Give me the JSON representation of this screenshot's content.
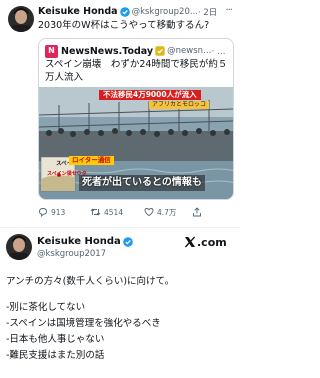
{
  "tweet": {
    "author_name": "Keisuke Honda",
    "handle": "@kskgroup20...",
    "time": "· 2日",
    "more_label": "···",
    "text": "2030年のW杯はこうやって移動するん?",
    "quote": {
      "source_name": "NewsNews.Today",
      "source_handle": "@newsne...",
      "source_time": "· 2日",
      "source_logo_letter": "N",
      "text": "スペイン崩壊　わずか24時間で移民が約５万人流入",
      "image": {
        "banner": "不法移民4万9000人が流入",
        "sub_banner": "アフリカとモロッコ",
        "reuters": "ロイター通信",
        "map_label": "スペイン",
        "map_sublabel": "スペイン領セウタ",
        "caption": "死者が出ているとの情報も"
      }
    },
    "actions": {
      "replies": "913",
      "retweets": "4514",
      "likes": "4.7万"
    }
  },
  "reply": {
    "author_name": "Keisuke Honda",
    "handle": "@kskgroup2017",
    "logo_text": ".com",
    "lines": [
      "アンチの方々(数千人くらい)に向けて。",
      "",
      "-別に茶化してない",
      "-スペインは国境管理を強化やるべき",
      "-日本も他人事じゃない",
      "-難民支援はまた別の話"
    ]
  },
  "colors": {
    "verified_blue": "#1d9bf0",
    "verified_gold": "#e2b719",
    "secondary_text": "#536471",
    "news_red": "#d81e1e"
  }
}
